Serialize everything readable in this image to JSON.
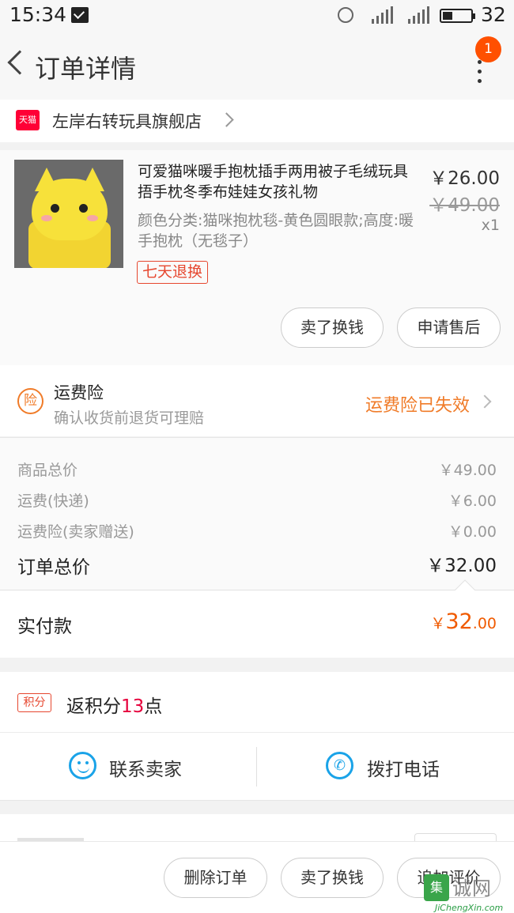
{
  "status_bar": {
    "time": "15:34",
    "battery": "32"
  },
  "header": {
    "title": "订单详情",
    "notification_count": "1"
  },
  "shop": {
    "badge": "天猫",
    "name": "左岸右转玩具旗舰店"
  },
  "product": {
    "name": "可爱猫咪暖手抱枕插手两用被子毛绒玩具捂手枕冬季布娃娃女孩礼物",
    "spec": "颜色分类:猫咪抱枕毯-黄色圆眼款;高度:暖手抱枕（无毯子）",
    "tag": "七天退换",
    "price": "￥26.00",
    "original_price": "￥49.00",
    "quantity": "x1",
    "buttons": {
      "sell": "卖了换钱",
      "after_sale": "申请售后"
    }
  },
  "insurance": {
    "icon_text": "险",
    "title": "运费险",
    "subtitle": "确认收货前退货可理赔",
    "status": "运费险已失效"
  },
  "summary": {
    "rows": [
      {
        "label": "商品总价",
        "value": "￥49.00"
      },
      {
        "label": "运费(快递)",
        "value": "￥6.00"
      },
      {
        "label": "运费险(卖家赠送)",
        "value": "￥0.00"
      }
    ],
    "total_label": "订单总价",
    "total_value": "￥32.00",
    "paid_label": "实付款",
    "paid_currency": "￥",
    "paid_int": "32",
    "paid_dec": ".00"
  },
  "points": {
    "tag": "积分",
    "prefix": "返积分",
    "value": "13",
    "suffix": "点"
  },
  "contact": {
    "chat": "联系卖家",
    "call": "拨打电话"
  },
  "actions": {
    "delete": "删除订单",
    "sell": "卖了换钱",
    "review": "追加评价"
  },
  "watermark": {
    "logo": "集",
    "cn": "诚网",
    "en": "JiChengXin.com"
  },
  "colors": {
    "accent_orange": "#ff5000",
    "price_orange": "#f05a00",
    "tmall_red": "#ff0036",
    "link_blue": "#1aa3e8"
  }
}
